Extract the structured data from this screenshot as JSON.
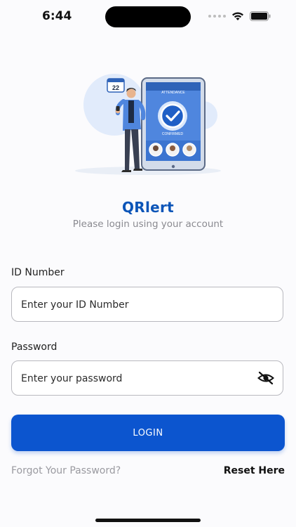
{
  "status_bar": {
    "time": "6:44"
  },
  "illustration": {
    "calendar_day": "22",
    "screen_header": "ATTENDANCE",
    "confirm_text": "CONFIRMED"
  },
  "brand": {
    "title": "QRlert",
    "subtitle": "Please login using your account"
  },
  "form": {
    "id_label": "ID Number",
    "id_placeholder": "Enter your ID Number",
    "id_value": "",
    "password_label": "Password",
    "password_placeholder": "Enter your password",
    "password_value": "",
    "password_toggle_icon": "eye-off-icon",
    "login_label": "LOGIN"
  },
  "footer": {
    "forgot_label": "Forgot Your Password?",
    "reset_label": "Reset Here"
  },
  "colors": {
    "primary": "#0c55cf",
    "brand_text": "#0c55b8",
    "muted": "#8a8a90"
  }
}
